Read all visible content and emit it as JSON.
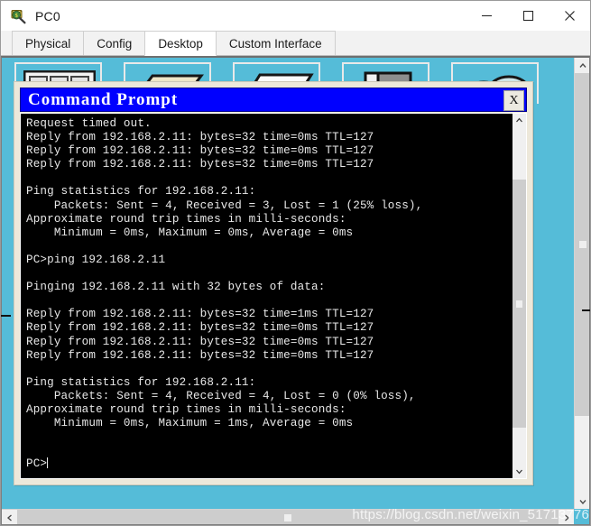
{
  "window": {
    "title": "PC0",
    "icon": "packet-tracer-pc-icon",
    "minimize_label": "─",
    "maximize_label": "□",
    "close_label": "✕"
  },
  "tabs": [
    {
      "label": "Physical",
      "active": false
    },
    {
      "label": "Config",
      "active": false
    },
    {
      "label": "Desktop",
      "active": true
    },
    {
      "label": "Custom Interface",
      "active": false
    }
  ],
  "desktop": {
    "background_color": "#55BCD8",
    "icons": [
      {
        "name": "ip-configuration-icon"
      },
      {
        "name": "dial-up-icon"
      },
      {
        "name": "terminal-icon"
      },
      {
        "name": "command-prompt-icon"
      },
      {
        "name": "web-browser-icon"
      }
    ]
  },
  "command_prompt": {
    "title": "Command Prompt",
    "title_bar_color": "#0000FF",
    "close_label": "X",
    "terminal_background": "#000000",
    "terminal_foreground": "#E8E8E8",
    "lines": [
      "Request timed out.",
      "Reply from 192.168.2.11: bytes=32 time=0ms TTL=127",
      "Reply from 192.168.2.11: bytes=32 time=0ms TTL=127",
      "Reply from 192.168.2.11: bytes=32 time=0ms TTL=127",
      "",
      "Ping statistics for 192.168.2.11:",
      "    Packets: Sent = 4, Received = 3, Lost = 1 (25% loss),",
      "Approximate round trip times in milli-seconds:",
      "    Minimum = 0ms, Maximum = 0ms, Average = 0ms",
      "",
      "PC>ping 192.168.2.11",
      "",
      "Pinging 192.168.2.11 with 32 bytes of data:",
      "",
      "Reply from 192.168.2.11: bytes=32 time=1ms TTL=127",
      "Reply from 192.168.2.11: bytes=32 time=0ms TTL=127",
      "Reply from 192.168.2.11: bytes=32 time=0ms TTL=127",
      "Reply from 192.168.2.11: bytes=32 time=0ms TTL=127",
      "",
      "Ping statistics for 192.168.2.11:",
      "    Packets: Sent = 4, Received = 4, Lost = 0 (0% loss),",
      "Approximate round trip times in milli-seconds:",
      "    Minimum = 0ms, Maximum = 1ms, Average = 0ms",
      "",
      ""
    ],
    "prompt": "PC>"
  },
  "scrollbars": {
    "up_arrow": "⌃",
    "down_arrow": "⌄",
    "left_arrow": "‹",
    "right_arrow": "›"
  },
  "watermark": {
    "text": "https://blog.csdn.net/weixin_51713776"
  }
}
